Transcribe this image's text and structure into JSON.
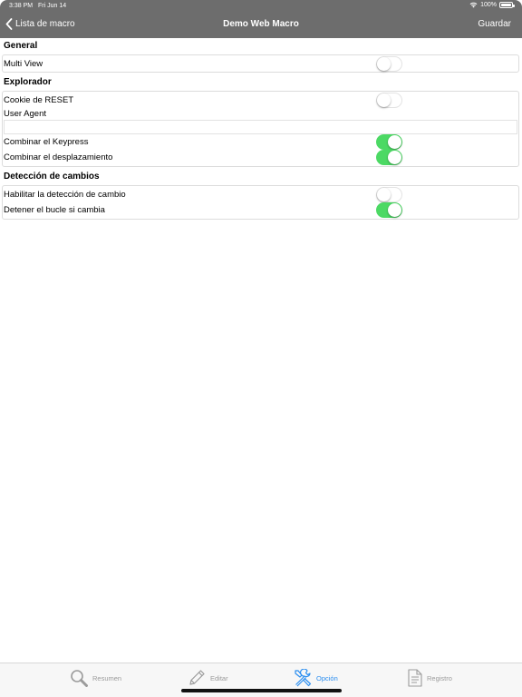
{
  "status": {
    "time": "3:38 PM",
    "date": "Fri Jun 14",
    "battery": "100%"
  },
  "nav": {
    "back_label": "Lista de macro",
    "title": "Demo Web Macro",
    "save_label": "Guardar"
  },
  "sections": {
    "general": {
      "header": "General",
      "multi_view": {
        "label": "Multi View",
        "on": false
      }
    },
    "explorer": {
      "header": "Explorador",
      "reset_cookie": {
        "label": "Cookie de RESET",
        "on": false
      },
      "user_agent": {
        "label": "User Agent",
        "value": ""
      },
      "combine_keypress": {
        "label": "Combinar el Keypress",
        "on": true
      },
      "combine_scroll": {
        "label": "Combinar el desplazamiento",
        "on": true
      }
    },
    "change_detection": {
      "header": "Detección de cambios",
      "enable_detection": {
        "label": "Habilitar la detección de cambio",
        "on": false
      },
      "stop_loop": {
        "label": "Detener el bucle si cambia",
        "on": true
      }
    }
  },
  "tabs": [
    {
      "label": "Resumen",
      "icon": "magnifier-icon",
      "active": false
    },
    {
      "label": "Editar",
      "icon": "pencil-icon",
      "active": false
    },
    {
      "label": "Opción",
      "icon": "tools-icon",
      "active": true
    },
    {
      "label": "Registro",
      "icon": "document-icon",
      "active": false
    }
  ],
  "colors": {
    "nav_bar": "#6d6d6d",
    "toggle_on": "#4cd964",
    "tab_active": "#2b8ef0",
    "tab_inactive": "#9b9b9b"
  }
}
